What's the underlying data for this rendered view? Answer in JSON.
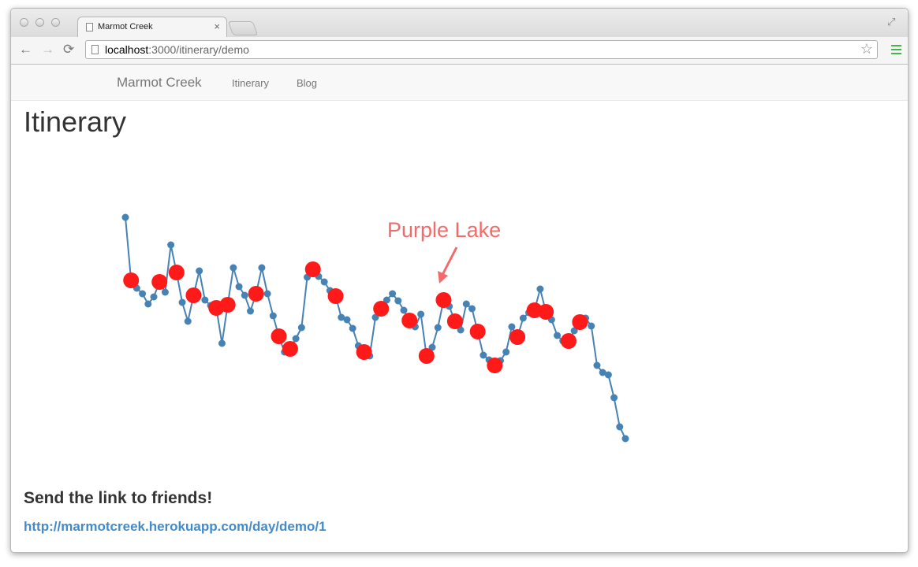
{
  "browser": {
    "tab_title": "Marmot Creek",
    "tab_close": "×",
    "url_host": "localhost",
    "url_path": ":3000/itinerary/demo",
    "back_icon": "←",
    "forward_icon": "→",
    "reload_icon": "⟳",
    "star_icon": "☆",
    "fullscreen_icon": "⤢"
  },
  "navbar": {
    "brand": "Marmot Creek",
    "links": [
      "Itinerary",
      "Blog"
    ]
  },
  "page": {
    "title": "Itinerary",
    "share_heading": "Send the link to friends!",
    "share_link": "http://marmotcreek.herokuapp.com/day/demo/1"
  },
  "chart_data": {
    "type": "line",
    "annotation": "Purple Lake",
    "line_color": "#4682b4",
    "marker_color": "#ff1a1a",
    "annotation_color": "#f26b6b",
    "series": [
      {
        "y": [
          -265,
          -345,
          -355,
          -362,
          -375,
          -366,
          -347,
          -360,
          -300,
          -335,
          -373,
          -397,
          -364,
          -333,
          -370,
          -377,
          -380,
          -425,
          -376,
          -329,
          -353,
          -364,
          -384,
          -362,
          -329,
          -362,
          -390,
          -416,
          -436,
          -432,
          -419,
          -405,
          -341,
          -331,
          -340,
          -347,
          -358,
          -365,
          -392,
          -395,
          -406,
          -428,
          -436,
          -441,
          -392,
          -381,
          -370,
          -362,
          -371,
          -383,
          -396,
          -404,
          -388,
          -441,
          -430,
          -405,
          -370,
          -378,
          -397,
          -408,
          -375,
          -381,
          -410,
          -440,
          -446,
          -453,
          -447,
          -436,
          -404,
          -417,
          -393,
          -386,
          -383,
          -356,
          -385,
          -395,
          -415,
          -422,
          -422,
          -409,
          -398,
          -393,
          -403,
          -453,
          -462,
          -465,
          -494,
          -531,
          -546
        ],
        "stops": [
          1,
          6,
          9,
          12,
          16,
          18,
          23,
          27,
          29,
          33,
          37,
          42,
          45,
          50,
          53,
          56,
          58,
          62,
          65,
          69,
          72,
          74,
          78,
          80
        ]
      }
    ]
  }
}
